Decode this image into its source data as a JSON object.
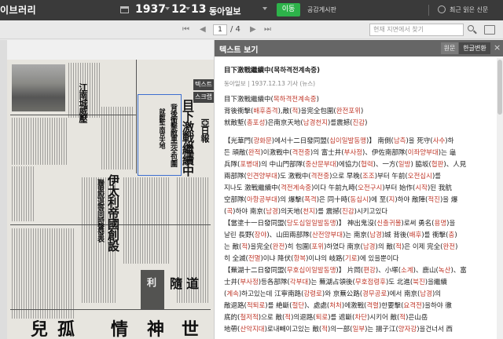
{
  "topbar": {
    "brand": "이브러리",
    "year": "1937",
    "month": "12",
    "day": "13",
    "newspaper": "동아일보",
    "go_label": "이동",
    "notice_label": "공감게시판",
    "recent_label": "최근 읽은 신문"
  },
  "toolbar": {
    "first_label": "⏮",
    "prev_label": "◀",
    "page_current": "1",
    "page_total": "/ 4",
    "next_label": "▶",
    "last_label": "⏭",
    "search_placeholder": "현재 지면에서 찾기"
  },
  "viewer": {
    "side_tab_1": "텍스트",
    "side_tab_2": "스크랩",
    "headline_right": "目下激戰繼續中",
    "headline_sub": "背後衝擊敵軍完全包圍",
    "headline_sub2": "就敵塹 南京天地",
    "masthead": "亞日報",
    "headline_left": "伊太利帝國創設",
    "headline_left2": "聯盟脫退等同時聲發表",
    "headline_mid": "江南城威壓",
    "ad_1": "兒",
    "ad_2": "孤",
    "ad_3": "情",
    "ad_4": "神",
    "ad_5": "世",
    "ad_6": "利",
    "ad_7": "隨",
    "ad_8": "道"
  },
  "panel": {
    "title": "텍스트 보기",
    "tab_original": "원문",
    "tab_converted": "한글변환",
    "close_label": "×",
    "article_title": "目下激戰繼續中(목하격전계속중)",
    "article_meta": "동아일보 | 1937.12.13 기사 (뉴스)",
    "lines": [
      [
        [
          "t",
          "目下激戰繼續中("
        ],
        [
          "r",
          "목하격전계속중"
        ],
        [
          "t",
          ")"
        ]
      ],
      [
        [
          "t",
          "背後衝擊("
        ],
        [
          "r",
          "배후충격"
        ],
        [
          "t",
          "),敵("
        ],
        [
          "r",
          "적"
        ],
        [
          "t",
          ")을完全包圍("
        ],
        [
          "r",
          "완전포위"
        ],
        [
          "t",
          ")"
        ]
      ],
      [
        [
          "t",
          "就敵塹("
        ],
        [
          "r",
          "총포성"
        ],
        [
          "t",
          ")은南京天地("
        ],
        [
          "r",
          "남경천지"
        ],
        [
          "t",
          ")를震撼("
        ],
        [
          "r",
          "진감"
        ],
        [
          "t",
          ")"
        ]
      ],
      [
        [
          "s",
          ""
        ]
      ],
      [
        [
          "t",
          "【光華門("
        ],
        [
          "r",
          "광화문"
        ],
        [
          "t",
          ")에서十二日發同盟("
        ],
        [
          "r",
          "십이일발동맹"
        ],
        [
          "t",
          ")】 南側("
        ],
        [
          "r",
          "남측"
        ],
        [
          "t",
          ")을 死守("
        ],
        [
          "r",
          "사수"
        ],
        [
          "t",
          ")하"
        ]
      ],
      [
        [
          "t",
          "든 頑敵("
        ],
        [
          "r",
          "완적"
        ],
        [
          "t",
          ")이激戰中("
        ],
        [
          "r",
          "격전중"
        ],
        [
          "t",
          ")의 富士井("
        ],
        [
          "r",
          "부사정"
        ],
        [
          "t",
          ")、伊佐南部隊("
        ],
        [
          "r",
          "이좌양부대"
        ],
        [
          "t",
          ")는 龜"
        ]
      ],
      [
        [
          "t",
          "兵隊("
        ],
        [
          "r",
          "포병대"
        ],
        [
          "t",
          ")의 中山門部隊("
        ],
        [
          "r",
          "중산문부대"
        ],
        [
          "t",
          ")에協力("
        ],
        [
          "r",
          "협력"
        ],
        [
          "t",
          ")、一方("
        ],
        [
          "r",
          "일방"
        ],
        [
          "t",
          ") 脇坂("
        ],
        [
          "r",
          "협판"
        ],
        [
          "t",
          ")、人見"
        ]
      ],
      [
        [
          "t",
          "兩部隊("
        ],
        [
          "r",
          "인견양부대"
        ],
        [
          "t",
          ")도 激戰中("
        ],
        [
          "r",
          "격전중"
        ],
        [
          "t",
          ")으로 早晚("
        ],
        [
          "r",
          "조조"
        ],
        [
          "t",
          ")부터 午前("
        ],
        [
          "r",
          "오전십시"
        ],
        [
          "t",
          ")를"
        ]
      ],
      [
        [
          "t",
          "지나도 激戰繼續中("
        ],
        [
          "r",
          "격전계속중"
        ],
        [
          "t",
          ")이다 午前九時("
        ],
        [
          "r",
          "오전구시"
        ],
        [
          "t",
          ")부터 始作("
        ],
        [
          "r",
          "시작"
        ],
        [
          "t",
          ")된 我航"
        ]
      ],
      [
        [
          "t",
          "空部隊("
        ],
        [
          "r",
          "아항공부대"
        ],
        [
          "t",
          ")의 爆擊("
        ],
        [
          "r",
          "폭격"
        ],
        [
          "t",
          ")은 同十時("
        ],
        [
          "r",
          "동십시"
        ],
        [
          "t",
          ")에 至("
        ],
        [
          "r",
          "지"
        ],
        [
          "t",
          ")하야 敵陣("
        ],
        [
          "r",
          "적진"
        ],
        [
          "t",
          ")을 爆"
        ]
      ],
      [
        [
          "t",
          "("
        ],
        [
          "r",
          "곡"
        ],
        [
          "t",
          ")하야 南京("
        ],
        [
          "r",
          "남경"
        ],
        [
          "t",
          ")의天地("
        ],
        [
          "r",
          "천지"
        ],
        [
          "t",
          ")를 震撼("
        ],
        [
          "r",
          "진감"
        ],
        [
          "t",
          ")시키고있다"
        ]
      ],
      [
        [
          "t",
          "【當塗十一日發同盟("
        ],
        [
          "r",
          "당도십일일발동맹"
        ],
        [
          "t",
          ")】 神出鬼沒("
        ],
        [
          "r",
          "신출귀몰"
        ],
        [
          "t",
          ")로써 勇名("
        ],
        [
          "r",
          "용명"
        ],
        [
          "t",
          ")을"
        ]
      ],
      [
        [
          "t",
          "날린 長野("
        ],
        [
          "r",
          "장야"
        ],
        [
          "t",
          ")、山田兩部隊("
        ],
        [
          "r",
          "산전양부대"
        ],
        [
          "t",
          ")는 南京("
        ],
        [
          "r",
          "남경"
        ],
        [
          "t",
          ")城 背後("
        ],
        [
          "r",
          "배후"
        ],
        [
          "t",
          ")를 衝擊("
        ],
        [
          "r",
          "충"
        ],
        [
          "t",
          ")"
        ]
      ],
      [
        [
          "t",
          "는 敵("
        ],
        [
          "r",
          "적"
        ],
        [
          "t",
          ")을完全("
        ],
        [
          "r",
          "완전"
        ],
        [
          "t",
          ")히 包圍("
        ],
        [
          "r",
          "포위"
        ],
        [
          "t",
          ")하였다 南京("
        ],
        [
          "r",
          "남경"
        ],
        [
          "t",
          ")의 敵("
        ],
        [
          "r",
          "적"
        ],
        [
          "t",
          ")은 이제 完全("
        ],
        [
          "r",
          "완전"
        ],
        [
          "t",
          ")"
        ]
      ],
      [
        [
          "t",
          "히 全滅("
        ],
        [
          "r",
          "전멸"
        ],
        [
          "t",
          ")이냐 降伏("
        ],
        [
          "r",
          "항복"
        ],
        [
          "t",
          ")이냐의 岐路("
        ],
        [
          "r",
          "기로"
        ],
        [
          "t",
          ")에 있을뿐이다"
        ]
      ],
      [
        [
          "t",
          "【蕪湖十二日發同盟("
        ],
        [
          "r",
          "무호십이일발동맹"
        ],
        [
          "t",
          ")】 片岡("
        ],
        [
          "r",
          "편강"
        ],
        [
          "t",
          ")、小塚("
        ],
        [
          "r",
          "소계"
        ],
        [
          "t",
          ")、鹿山("
        ],
        [
          "r",
          "녹산"
        ],
        [
          "t",
          ")、富"
        ]
      ],
      [
        [
          "t",
          "士井("
        ],
        [
          "r",
          "부사정"
        ],
        [
          "t",
          ")등各部隊("
        ],
        [
          "r",
          "각부대"
        ],
        [
          "t",
          ")는 蕪湖占領後("
        ],
        [
          "r",
          "무호점령후"
        ],
        [
          "t",
          ")도 北進("
        ],
        [
          "r",
          "북진"
        ],
        [
          "t",
          ")을繼續"
        ]
      ],
      [
        [
          "t",
          "("
        ],
        [
          "r",
          "계속"
        ],
        [
          "t",
          ")하고있는데 江寧南路("
        ],
        [
          "r",
          "강령로"
        ],
        [
          "t",
          ")와 京蕪公路("
        ],
        [
          "r",
          "경무공로"
        ],
        [
          "t",
          ")에서 南京("
        ],
        [
          "r",
          "남경"
        ],
        [
          "t",
          ")의"
        ]
      ],
      [
        [
          "t",
          "敵退路("
        ],
        [
          "r",
          "적퇴로"
        ],
        [
          "t",
          ")를 絶斷("
        ],
        [
          "r",
          "절단"
        ],
        [
          "t",
          ")、處處("
        ],
        [
          "r",
          "처처"
        ],
        [
          "t",
          ")에激戰("
        ],
        [
          "r",
          "격렬"
        ],
        [
          "t",
          ")한要擊("
        ],
        [
          "r",
          "요격전"
        ],
        [
          "t",
          ")을하야 徹"
        ]
      ],
      [
        [
          "t",
          "底的("
        ],
        [
          "r",
          "철저적"
        ],
        [
          "t",
          ")으로 敵("
        ],
        [
          "r",
          "적"
        ],
        [
          "t",
          ")의退路("
        ],
        [
          "r",
          "퇴로"
        ],
        [
          "t",
          ")를 遮斷("
        ],
        [
          "r",
          "차단"
        ],
        [
          "t",
          ")시키어 敵("
        ],
        [
          "r",
          "적"
        ],
        [
          "t",
          ")은山岳"
        ]
      ],
      [
        [
          "t",
          "地帶("
        ],
        [
          "r",
          "산악지대"
        ],
        [
          "t",
          ")로내빼이고있는 敵("
        ],
        [
          "r",
          "적"
        ],
        [
          "t",
          ")의一部("
        ],
        [
          "r",
          "일부"
        ],
        [
          "t",
          ")는 揚子江("
        ],
        [
          "r",
          "양자강"
        ],
        [
          "t",
          ")을건너서 西"
        ]
      ]
    ]
  }
}
